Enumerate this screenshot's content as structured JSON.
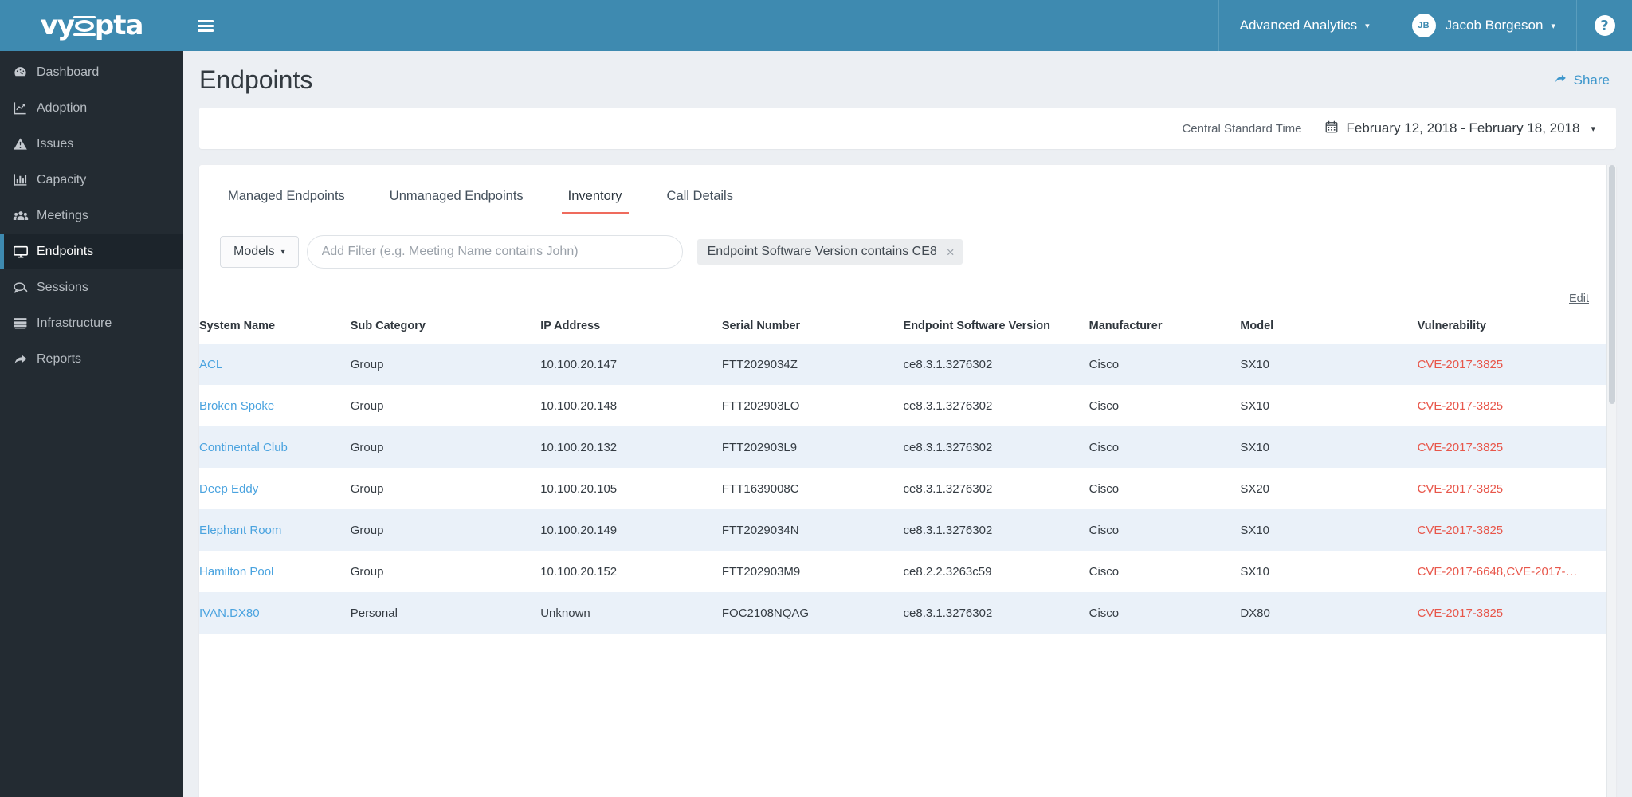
{
  "brand": {
    "logo_text": "vyopta",
    "header_color": "#3e8ab0",
    "sidebar_color": "#232b32",
    "accent_color": "#ef6b5d",
    "link_color": "#4aa3df",
    "danger_color": "#e8564a"
  },
  "sidebar": {
    "items": [
      {
        "label": "Dashboard",
        "icon": "dashboard-icon",
        "active": false
      },
      {
        "label": "Adoption",
        "icon": "chart-line-icon",
        "active": false
      },
      {
        "label": "Issues",
        "icon": "warning-triangle-icon",
        "active": false
      },
      {
        "label": "Capacity",
        "icon": "bar-chart-icon",
        "active": false
      },
      {
        "label": "Meetings",
        "icon": "users-icon",
        "active": false
      },
      {
        "label": "Endpoints",
        "icon": "monitor-icon",
        "active": true
      },
      {
        "label": "Sessions",
        "icon": "chat-bubbles-icon",
        "active": false
      },
      {
        "label": "Infrastructure",
        "icon": "server-rack-icon",
        "active": false
      },
      {
        "label": "Reports",
        "icon": "share-arrow-icon",
        "active": false
      }
    ]
  },
  "topbar": {
    "menu_icon": "hamburger-icon",
    "product_selector": "Advanced Analytics",
    "user_initials": "JB",
    "user_name": "Jacob Borgeson",
    "help_icon": "question-mark-icon",
    "caret": "▾"
  },
  "page": {
    "title": "Endpoints",
    "share_label": "Share",
    "share_icon": "share-arrow-icon",
    "timezone": "Central Standard Time",
    "date_range": "February 12, 2018 - February 18, 2018",
    "calendar_icon": "calendar-icon"
  },
  "tabs": [
    {
      "label": "Managed Endpoints",
      "active": false
    },
    {
      "label": "Unmanaged Endpoints",
      "active": false
    },
    {
      "label": "Inventory",
      "active": true
    },
    {
      "label": "Call Details",
      "active": false
    }
  ],
  "filters": {
    "models_label": "Models",
    "models_caret": "▾",
    "filter_placeholder": "Add Filter (e.g. Meeting Name contains John)",
    "filter_value": "",
    "chips": [
      {
        "label": "Endpoint Software Version contains CE8",
        "remove_icon": "close-icon"
      }
    ]
  },
  "table": {
    "edit_label": "Edit",
    "columns": [
      "System Name",
      "Sub Category",
      "IP Address",
      "Serial Number",
      "Endpoint Software Version",
      "Manufacturer",
      "Model",
      "Vulnerability"
    ],
    "rows": [
      {
        "system_name": "ACL",
        "sub_category": "Group",
        "ip_address": "10.100.20.147",
        "serial_number": "FTT2029034Z",
        "software_version": "ce8.3.1.3276302",
        "manufacturer": "Cisco",
        "model": "SX10",
        "vulnerability": "CVE-2017-3825"
      },
      {
        "system_name": "Broken Spoke",
        "sub_category": "Group",
        "ip_address": "10.100.20.148",
        "serial_number": "FTT202903LO",
        "software_version": "ce8.3.1.3276302",
        "manufacturer": "Cisco",
        "model": "SX10",
        "vulnerability": "CVE-2017-3825"
      },
      {
        "system_name": "Continental Club",
        "sub_category": "Group",
        "ip_address": "10.100.20.132",
        "serial_number": "FTT202903L9",
        "software_version": "ce8.3.1.3276302",
        "manufacturer": "Cisco",
        "model": "SX10",
        "vulnerability": "CVE-2017-3825"
      },
      {
        "system_name": "Deep Eddy",
        "sub_category": "Group",
        "ip_address": "10.100.20.105",
        "serial_number": "FTT1639008C",
        "software_version": "ce8.3.1.3276302",
        "manufacturer": "Cisco",
        "model": "SX20",
        "vulnerability": "CVE-2017-3825"
      },
      {
        "system_name": "Elephant Room",
        "sub_category": "Group",
        "ip_address": "10.100.20.149",
        "serial_number": "FTT2029034N",
        "software_version": "ce8.3.1.3276302",
        "manufacturer": "Cisco",
        "model": "SX10",
        "vulnerability": "CVE-2017-3825"
      },
      {
        "system_name": "Hamilton Pool",
        "sub_category": "Group",
        "ip_address": "10.100.20.152",
        "serial_number": "FTT202903M9",
        "software_version": "ce8.2.2.3263c59",
        "manufacturer": "Cisco",
        "model": "SX10",
        "vulnerability": "CVE-2017-6648,CVE-2017-…"
      },
      {
        "system_name": "IVAN.DX80",
        "sub_category": "Personal",
        "ip_address": "Unknown",
        "serial_number": "FOC2108NQAG",
        "software_version": "ce8.3.1.3276302",
        "manufacturer": "Cisco",
        "model": "DX80",
        "vulnerability": "CVE-2017-3825"
      }
    ]
  }
}
